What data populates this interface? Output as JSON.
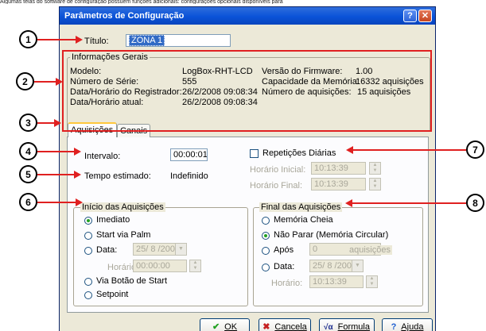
{
  "top_cut_text": "Algumas telas do software de configuração possuem funções adicionais: configurações opcionais disponíveis para",
  "window": {
    "title": "Parâmetros de Configuração",
    "help_button": "?",
    "close_button": "✕"
  },
  "titulo": {
    "label": "Título:",
    "value": "ZONA 1"
  },
  "info": {
    "legend": "Informações Gerais",
    "modelo_label": "Modelo:",
    "modelo_value": "LogBox-RHT-LCD",
    "serie_label": "Número de Série:",
    "serie_value": "555",
    "data_reg_label": "Data/Horário do Registrador:",
    "data_reg_value": "26/2/2008 09:08:34",
    "data_atual_label": "Data/Horário atual:",
    "data_atual_value": "26/2/2008 09:08:34",
    "firmware_label": "Versão do Firmware:",
    "firmware_value": "1.00",
    "capacidade_label": "Capacidade da Memória:",
    "capacidade_value": "16332 aquisições",
    "num_aq_label": "Número de aquisições:",
    "num_aq_value": "15 aquisições"
  },
  "tabs": [
    {
      "label": "Aquisições",
      "active": true
    },
    {
      "label": "Canais",
      "active": false
    }
  ],
  "aquisicoes": {
    "intervalo_label": "Intervalo:",
    "intervalo_value": "00:00:01",
    "tempo_label": "Tempo estimado:",
    "tempo_value": "Indefinido",
    "repeticoes_label": "Repetições Diárias",
    "horario_inicial_label": "Horário Inicial:",
    "horario_inicial_value": "10:13:39",
    "horario_final_label": "Horário Final:",
    "horario_final_value": "10:13:39"
  },
  "inicio": {
    "legend": "Início das Aquisições",
    "imediato": "Imediato",
    "palm": "Start via Palm",
    "data_label": "Data:",
    "data_value": "25/ 8 /2003",
    "horario_label": "Horário:",
    "horario_value": "00:00:00",
    "botao": "Via Botão de Start",
    "setpoint": "Setpoint"
  },
  "final": {
    "legend": "Final das Aquisições",
    "memoria_cheia": "Memória Cheia",
    "nao_parar": "Não Parar (Memória Circular)",
    "apos_label": "Após",
    "apos_value": "0",
    "apos_unit": "aquisições",
    "data_label": "Data:",
    "data_value": "25/ 8 /2003",
    "horario_label": "Horário:",
    "horario_value": "10:13:39"
  },
  "buttons": {
    "ok": "OK",
    "cancel": "Cancela",
    "formula": "Formula",
    "help": "Ajuda"
  },
  "icons": {
    "ok": "✔",
    "cancel": "✖",
    "formula": "√α",
    "help": "?"
  },
  "callouts": [
    "1",
    "2",
    "3",
    "4",
    "5",
    "6",
    "7",
    "8"
  ],
  "colors": {
    "annotation": "#e02020",
    "titlebar": "#0a53d8"
  }
}
